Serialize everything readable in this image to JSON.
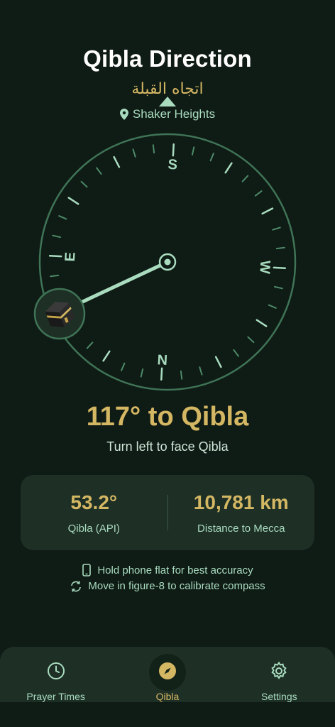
{
  "header": {
    "title": "Qibla Direction",
    "subtitle_arabic": "اتجاه القبلة",
    "location": "Shaker Heights"
  },
  "compass": {
    "cardinals": [
      "N",
      "E",
      "S",
      "W"
    ],
    "qibla_bearing_deg": 53.2,
    "relative_angle_deg": 117,
    "kaaba_icon": "kaaba-icon"
  },
  "status": {
    "heading": "117° to Qibla",
    "instruction": "Turn left to face Qibla"
  },
  "info": {
    "qibla_value": "53.2°",
    "qibla_label": "Qibla (API)",
    "distance_value": "10,781 km",
    "distance_label": "Distance to Mecca"
  },
  "tips": [
    {
      "icon": "phone-icon",
      "text": "Hold phone flat for best accuracy"
    },
    {
      "icon": "refresh-icon",
      "text": "Move in figure-8 to calibrate compass"
    }
  ],
  "nav": {
    "items": [
      {
        "label": "Prayer Times",
        "icon": "clock-icon",
        "active": false
      },
      {
        "label": "Qibla",
        "icon": "compass-icon",
        "active": true
      },
      {
        "label": "Settings",
        "icon": "gear-icon",
        "active": false
      }
    ]
  },
  "colors": {
    "background": "#0f1b15",
    "accent_gold": "#d4b763",
    "mint": "#a9dcbf",
    "card": "#1e2f25"
  }
}
